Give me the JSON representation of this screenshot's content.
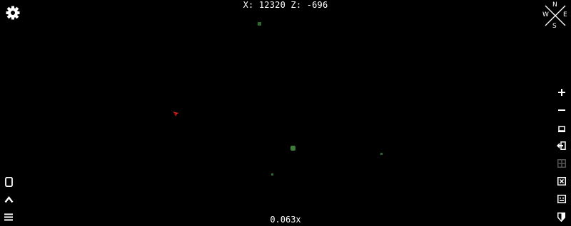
{
  "coordinates": "X: 12320 Z: -696",
  "zoom_level": "0.063x",
  "compass": {
    "n": "N",
    "e": "E",
    "s": "S",
    "w": "W"
  },
  "colors": {
    "background": "#000000",
    "player_marker": "#d42020",
    "entity_marker": "#2f6b2f",
    "ui": "#ffffff"
  },
  "icons": {
    "settings": "gear-icon",
    "compass": "compass-icon",
    "zoom_in": "plus-icon",
    "zoom_out": "minus-icon",
    "toolbar_right": [
      "window-icon",
      "exit-icon",
      "grid-icon",
      "close-box-icon",
      "face-box-icon",
      "shield-icon"
    ],
    "toolbar_left": [
      "phone-icon",
      "chevron-up-icon",
      "menu-icon"
    ]
  },
  "markers": [
    "player-marker",
    "entity-marker",
    "entity-marker",
    "entity-marker",
    "entity-marker"
  ]
}
